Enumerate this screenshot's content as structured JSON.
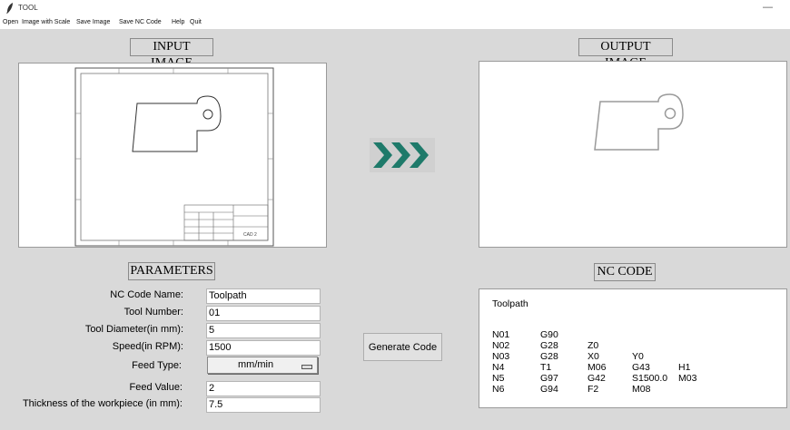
{
  "window": {
    "title": "TOOL",
    "minimize_glyph": "—"
  },
  "menu": [
    "Open",
    "Image with Scale",
    "Save Image",
    "Save NC Code",
    "Help",
    "Quit"
  ],
  "input_label": "INPUT IMAGE",
  "output_label": "OUTPUT IMAGE",
  "parameters_label": "PARAMETERS",
  "nc_code_label": "NC CODE",
  "drawing_title_block_text": "CAD 2",
  "parameters": [
    {
      "label": "NC Code Name:",
      "value": "Toolpath"
    },
    {
      "label": "Tool Number:",
      "value": "01"
    },
    {
      "label": "Tool Diameter(in mm):",
      "value": "5"
    },
    {
      "label": "Speed(in RPM):",
      "value": "1500"
    },
    {
      "label": "Feed Type:",
      "value": "mm/min"
    },
    {
      "label": "Feed Value:",
      "value": "2"
    },
    {
      "label": "Thickness of the workpiece (in mm):",
      "value": "7.5"
    }
  ],
  "generate_button": "Generate Code",
  "nc_code": {
    "title": "Toolpath",
    "lines": [
      [
        "N01",
        "G90",
        "",
        "",
        ""
      ],
      [
        "N02",
        "G28",
        "Z0",
        "",
        ""
      ],
      [
        "N03",
        "G28",
        "X0",
        "Y0",
        ""
      ],
      [
        "N4",
        "T1",
        "M06",
        "G43",
        "H1"
      ],
      [
        "N5",
        "G97",
        "G42",
        "S1500.0",
        "M03"
      ],
      [
        "N6",
        "G94",
        "F2",
        "M08",
        ""
      ]
    ]
  },
  "icons": {
    "app": "feather-icon",
    "arrow": "triple-chevron-right-icon"
  },
  "colors": {
    "arrow": "#1e7a6a",
    "background": "#d9d9d9"
  }
}
